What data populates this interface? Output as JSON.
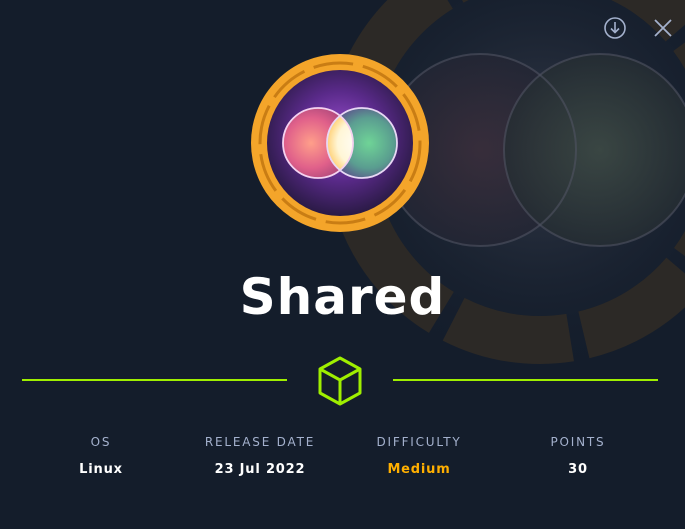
{
  "machine": {
    "name": "Shared"
  },
  "stats": [
    {
      "label": "OS",
      "value": "Linux"
    },
    {
      "label": "RELEASE DATE",
      "value": "23 Jul 2022"
    },
    {
      "label": "DIFFICULTY",
      "value": "Medium"
    },
    {
      "label": "POINTS",
      "value": "30"
    }
  ],
  "icons": {
    "download": "download-icon",
    "close": "close-icon",
    "divider": "cube-icon"
  },
  "colors": {
    "background": "#141d2b",
    "accent_green": "#9fef00",
    "difficulty_medium": "#ffaf00",
    "ring_orange": "#f4a52a",
    "label": "#a4b1cd"
  }
}
